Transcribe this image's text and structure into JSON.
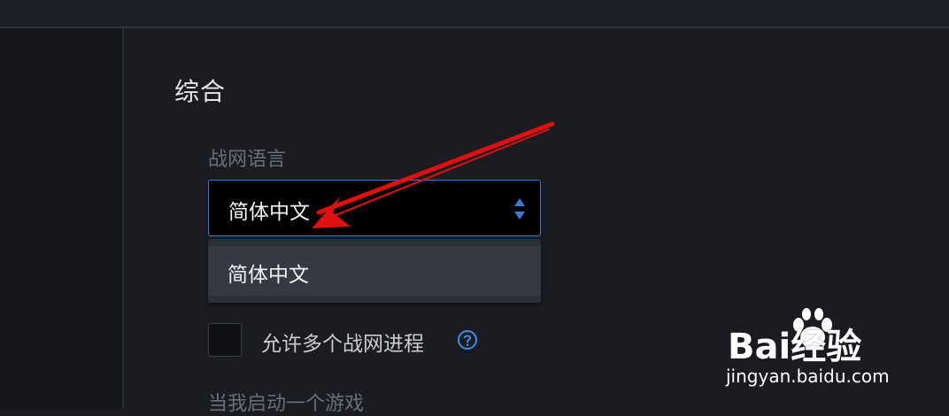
{
  "section": {
    "title": "综合"
  },
  "language": {
    "label": "战网语言",
    "selected_value": "简体中文",
    "options": [
      "简体中文"
    ]
  },
  "multi_process": {
    "label": "允许多个战网进程",
    "checked": false
  },
  "next_section": {
    "label": "当我启动一个游戏"
  },
  "watermark": {
    "brand": "Bai经验",
    "domain": "jingyan.baidu.com"
  },
  "colors": {
    "accent_blue": "#3a7bd5",
    "arrow_red": "#e01010"
  }
}
